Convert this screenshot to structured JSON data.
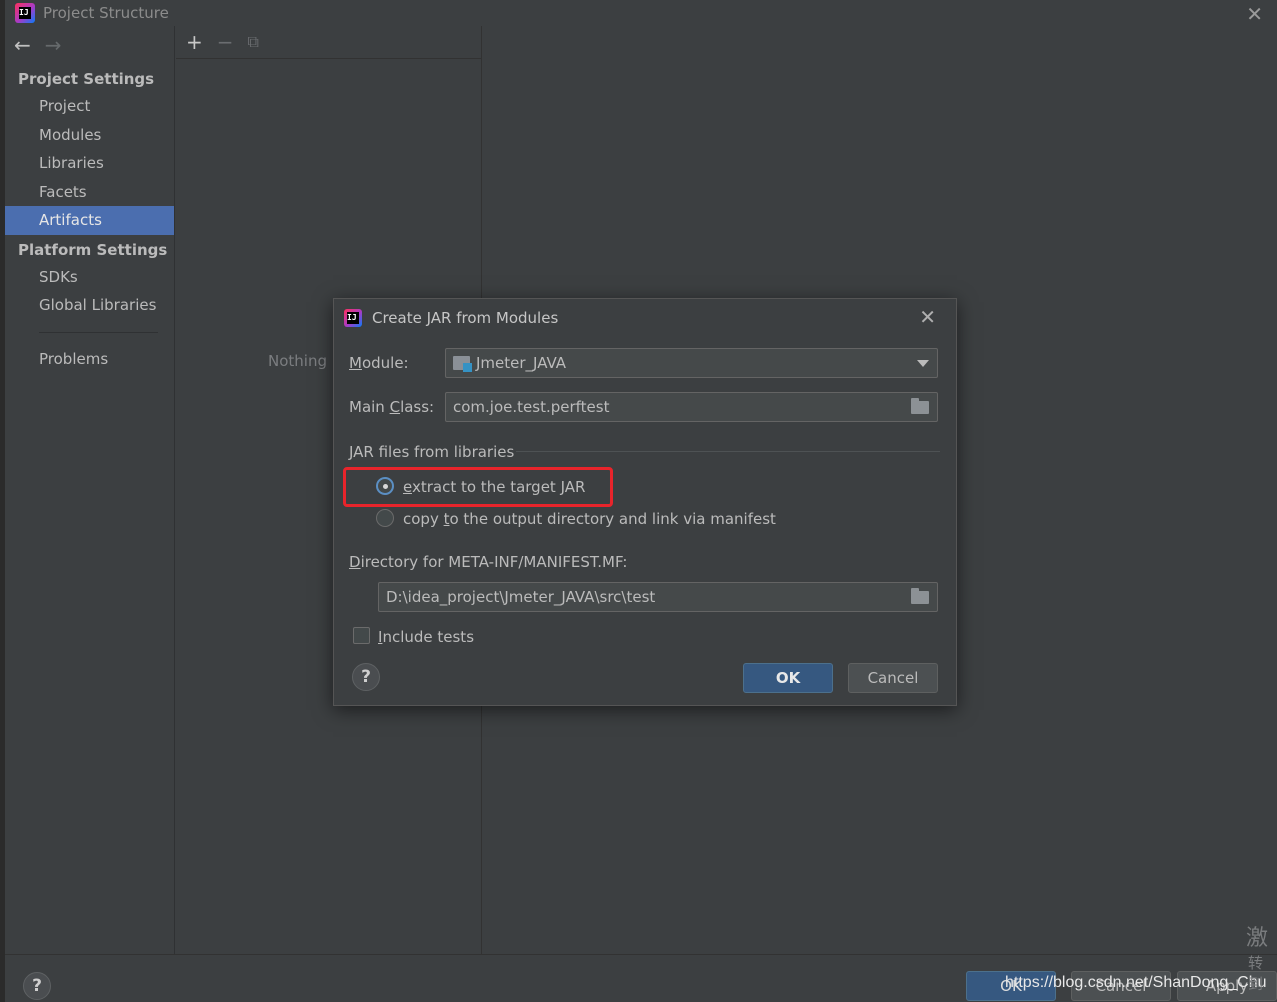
{
  "window": {
    "title": "Project Structure",
    "close_glyph": "✕"
  },
  "nav": {
    "back_glyph": "←",
    "forward_glyph": "→"
  },
  "sidebar": {
    "project_settings_label": "Project Settings",
    "project_items": [
      {
        "label": "Project"
      },
      {
        "label": "Modules"
      },
      {
        "label": "Libraries"
      },
      {
        "label": "Facets"
      },
      {
        "label": "Artifacts",
        "active": true
      }
    ],
    "platform_settings_label": "Platform Settings",
    "platform_items": [
      {
        "label": "SDKs"
      },
      {
        "label": "Global Libraries"
      }
    ],
    "problems_label": "Problems"
  },
  "middle_pane": {
    "toolbar": {
      "add_glyph": "+",
      "remove_glyph": "−",
      "copy_glyph": "⧉"
    },
    "empty_text": "Nothing"
  },
  "bottom_bar": {
    "help_glyph": "?",
    "ok_label": "OK",
    "cancel_label": "Cancel",
    "apply_label": "Apply",
    "watermark": "https://blog.csdn.net/ShanDong_Chu",
    "cjk_line1": "激",
    "cjk_line2": "转到"
  },
  "dialog": {
    "title": "Create JAR from Modules",
    "close_glyph": "✕",
    "module_label_u": "M",
    "module_label_rest": "odule:",
    "module_value": "Jmeter_JAVA",
    "main_class_label_a": "Main ",
    "main_class_label_u": "C",
    "main_class_label_b": "lass:",
    "main_class_value": "com.joe.test.perftest",
    "jar_group_label": "JAR files from libraries",
    "option_extract_u": "e",
    "option_extract_rest": "xtract to the target JAR",
    "option_copy_a": "copy ",
    "option_copy_u": "t",
    "option_copy_b": "o the output directory and link via manifest",
    "selected_option": "extract",
    "manifest_dir_label_u": "D",
    "manifest_dir_label_rest": "irectory for META-INF/MANIFEST.MF:",
    "manifest_dir_value": "D:\\idea_project\\Jmeter_JAVA\\src\\test",
    "include_tests_u": "I",
    "include_tests_rest": "nclude tests",
    "include_tests_checked": false,
    "help_glyph": "?",
    "ok_label": "OK",
    "cancel_label": "Cancel"
  },
  "colors": {
    "background": "#3c3f41",
    "selection": "#4b6eaf",
    "primary_button": "#365880",
    "highlight_box": "#e8242b"
  }
}
